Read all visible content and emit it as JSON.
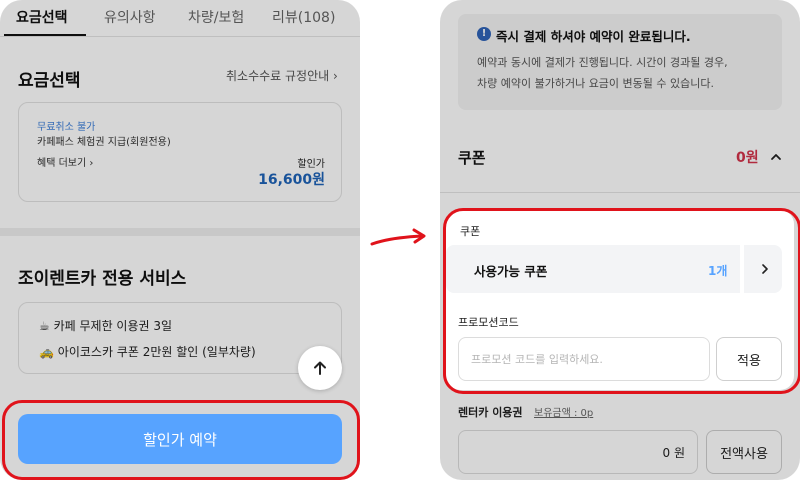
{
  "left": {
    "tabs": [
      {
        "label": "요금선택",
        "active": true
      },
      {
        "label": "유의사항",
        "active": false
      },
      {
        "label": "차량/보험",
        "active": false
      },
      {
        "label": "리뷰(108)",
        "active": false
      }
    ],
    "rate_section": {
      "title": "요금선택",
      "cancel_policy_link": "취소수수료 규정안내",
      "plan": {
        "tag": "무료취소 불가",
        "name": "카페패스 체험권 지급(회원전용)",
        "more_benefits": "혜택 더보기",
        "price_label": "할인가",
        "price": "16,600원"
      }
    },
    "services": {
      "title": "조이렌트카 전용 서비스",
      "items": [
        {
          "icon": "☕",
          "text": "카페 무제한 이용권 3일"
        },
        {
          "icon": "🚕",
          "text": "아이코스카 쿠폰 2만원 할인 (일부차량)"
        }
      ]
    },
    "cta_label": "할인가 예약"
  },
  "right": {
    "notice": {
      "icon": "!",
      "title": "즉시 결제 하셔야 예약이 완료됩니다.",
      "body_line1": "예약과 동시에 결제가 진행됩니다. 시간이 경과될 경우,",
      "body_line2": "차량 예약이 불가하거나 요금이 변동될 수 있습니다."
    },
    "coupon_header": {
      "title": "쿠폰",
      "amount": "0원"
    },
    "coupon_section": {
      "label": "쿠폰",
      "available_label": "사용가능 쿠폰",
      "available_count": "1개"
    },
    "promo": {
      "label": "프로모션코드",
      "placeholder": "프로모션 코드를 입력하세요.",
      "apply_label": "적용"
    },
    "rental_voucher": {
      "label": "렌터카 이용권",
      "balance_label": "보유금액 : 0p",
      "value": "0 원",
      "use_all_label": "전액사용"
    }
  },
  "colors": {
    "highlight": "#e0131b",
    "cta": "#57a3ff",
    "price_blue": "#1e63b8",
    "coupon_amount": "#d3334a"
  }
}
